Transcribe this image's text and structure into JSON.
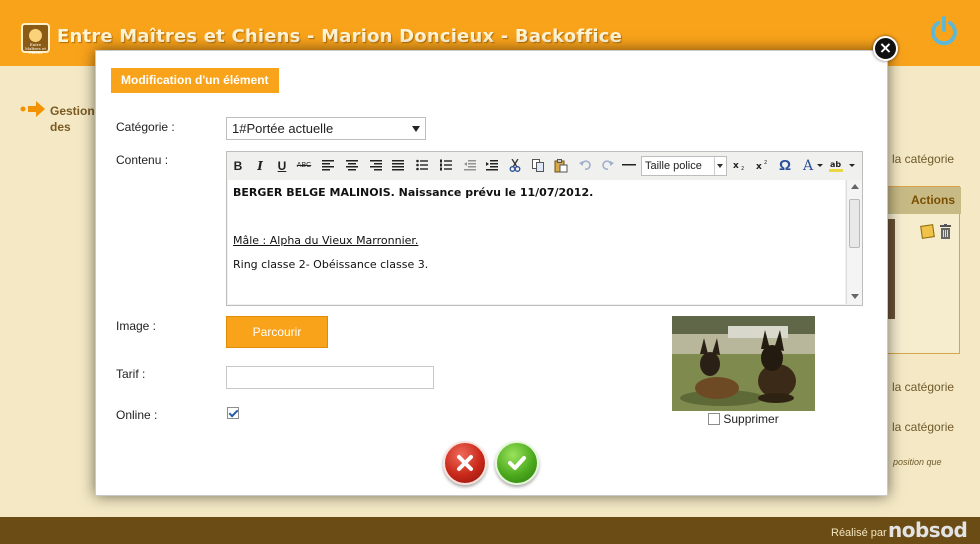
{
  "header": {
    "logo_text": "Entre Maîtres et Chiens",
    "title": "Entre Maîtres et Chiens - Marion Doncieux - Backoffice"
  },
  "background": {
    "nav_label": "Gestion des prestations",
    "links": [
      "la catégorie",
      "la catégorie",
      "la catégorie"
    ],
    "actions_header": "Actions",
    "small_text": "position que"
  },
  "modal": {
    "title": "Modification d'un élément",
    "labels": {
      "category": "Catégorie :",
      "content": "Contenu :",
      "image": "Image :",
      "price": "Tarif :",
      "online": "Online :"
    },
    "category": {
      "selected": "1#Portée actuelle"
    },
    "editor": {
      "font_size_select": "Taille police",
      "toolbar_labels": {
        "bold": "B",
        "italic": "I",
        "underline": "U",
        "strikethrough": "ABC",
        "text_color": "A",
        "special_char": "Ω"
      },
      "paragraphs": [
        "BERGER BELGE MALINOIS. Naissance prévu le 11/07/2012.",
        "Mâle : Alpha du Vieux Marronnier.",
        "Ring classe 2- Obéissance classe 3."
      ]
    },
    "browse_label": "Parcourir",
    "price_value": "",
    "online_checked": true,
    "delete_label": "Supprimer",
    "delete_checked": false
  },
  "footer": {
    "label": "Réalisé par",
    "brand": "nobsod"
  },
  "colors": {
    "accent": "#f9a31b",
    "footer": "#6a4c14",
    "background": "#f4e9c4"
  }
}
